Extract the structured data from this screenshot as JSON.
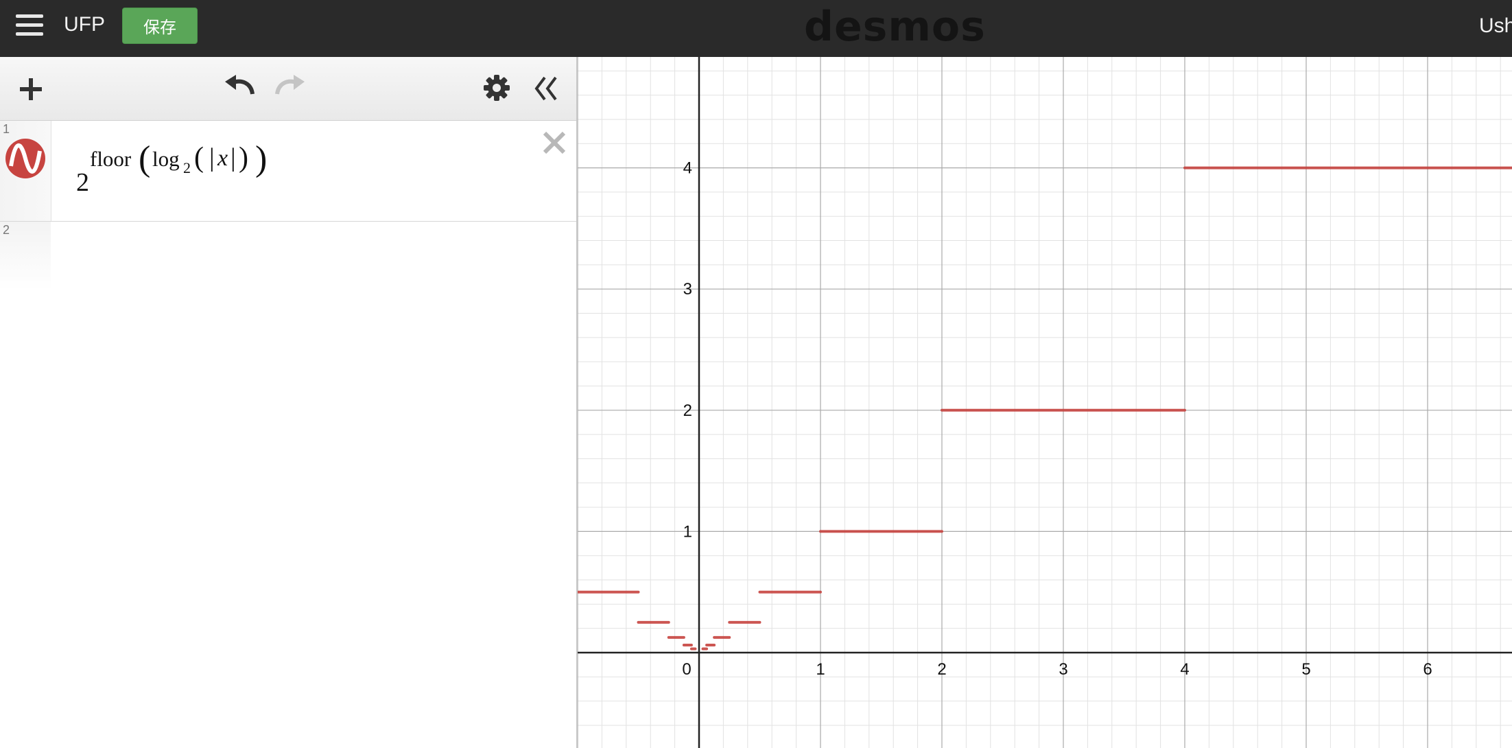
{
  "header": {
    "menu_icon": "hamburger-menu-icon",
    "title": "UFP",
    "save_label": "保存",
    "logo": "desmos",
    "user_name": "Ush"
  },
  "toolbar": {
    "add_icon": "plus-icon",
    "undo_icon": "undo-icon",
    "redo_icon": "redo-icon",
    "settings_icon": "gear-icon",
    "collapse_icon": "double-chevron-left-icon"
  },
  "expressions": [
    {
      "index": "1",
      "icon": "graph-wave-icon",
      "color": "#c74440",
      "latex_parts": {
        "base": "2",
        "func": "floor",
        "log": "log",
        "log_base": "2",
        "var": "x"
      },
      "delete_icon": "close-icon"
    },
    {
      "index": "2",
      "latex_parts": null
    }
  ],
  "graph": {
    "x_ticks": [
      "0",
      "1",
      "2",
      "3",
      "4",
      "5",
      "6"
    ],
    "y_ticks": [
      "1",
      "2",
      "3",
      "4"
    ],
    "curve_color": "#c74440"
  },
  "colors": {
    "header_bg": "#2a2a2a",
    "save_green": "#5aa658",
    "curve": "#c74440"
  },
  "chart_data": {
    "type": "line",
    "expression": "2^{floor(log_2(|x|))}",
    "xlim": [
      -1,
      6.7
    ],
    "ylim": [
      -0.8,
      4.9
    ],
    "grid": true,
    "x_ticks": [
      0,
      1,
      2,
      3,
      4,
      5,
      6
    ],
    "y_ticks": [
      1,
      2,
      3,
      4
    ],
    "series": [
      {
        "segments": [
          {
            "x": [
              -1,
              -0.5
            ],
            "y": 0.5
          },
          {
            "x": [
              -0.5,
              -0.25
            ],
            "y": 0.25
          },
          {
            "x": [
              -0.25,
              -0.125
            ],
            "y": 0.125
          },
          {
            "x": [
              -0.125,
              -0.0625
            ],
            "y": 0.0625
          },
          {
            "x": [
              -0.0625,
              -0.03125
            ],
            "y": 0.03125
          },
          {
            "x": [
              0.03125,
              0.0625
            ],
            "y": 0.03125
          },
          {
            "x": [
              0.0625,
              0.125
            ],
            "y": 0.0625
          },
          {
            "x": [
              0.125,
              0.25
            ],
            "y": 0.125
          },
          {
            "x": [
              0.25,
              0.5
            ],
            "y": 0.25
          },
          {
            "x": [
              0.5,
              1
            ],
            "y": 0.5
          },
          {
            "x": [
              1,
              2
            ],
            "y": 1
          },
          {
            "x": [
              2,
              4
            ],
            "y": 2
          },
          {
            "x": [
              4,
              6.7
            ],
            "y": 4
          }
        ]
      }
    ]
  }
}
